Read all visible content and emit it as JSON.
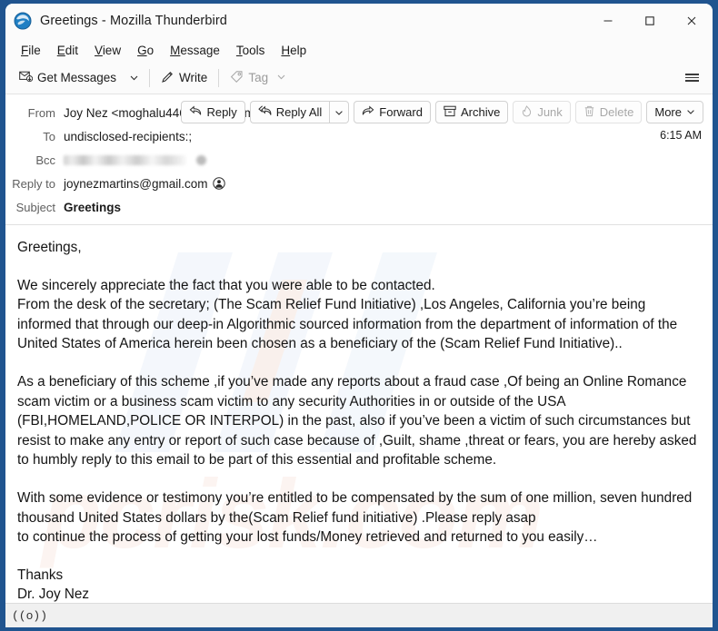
{
  "window": {
    "title": "Greetings - Mozilla Thunderbird",
    "logo_icon": "thunderbird-logo",
    "controls": {
      "minimize": "minimize-icon",
      "maximize": "maximize-icon",
      "close": "close-icon"
    }
  },
  "menubar": {
    "items": [
      {
        "label": "File",
        "accel": "F"
      },
      {
        "label": "Edit",
        "accel": "E"
      },
      {
        "label": "View",
        "accel": "V"
      },
      {
        "label": "Go",
        "accel": "G"
      },
      {
        "label": "Message",
        "accel": "M"
      },
      {
        "label": "Tools",
        "accel": "T"
      },
      {
        "label": "Help",
        "accel": "H"
      }
    ]
  },
  "toolbar": {
    "get_messages_label": "Get Messages",
    "get_messages_icon": "envelope-download-icon",
    "get_messages_caret": "chevron-down-icon",
    "write_label": "Write",
    "write_icon": "pencil-icon",
    "tag_label": "Tag",
    "tag_icon": "tag-icon",
    "tag_caret": "chevron-down-icon",
    "tag_disabled": true,
    "app_menu_icon": "hamburger-menu-icon"
  },
  "message_header": {
    "rows": [
      {
        "label": "From",
        "value": "Joy Nez <moghalu446@gmail.com>",
        "avatar": "contact-avatar-icon",
        "bold": false,
        "redacted": false
      },
      {
        "label": "To",
        "value": "undisclosed-recipients:;",
        "avatar": null,
        "bold": false,
        "redacted": false
      },
      {
        "label": "Bcc",
        "value": "",
        "avatar": null,
        "bold": false,
        "redacted": true
      },
      {
        "label": "Reply to",
        "value": "joynezmartins@gmail.com",
        "avatar": "contact-avatar-icon",
        "bold": false,
        "redacted": false
      },
      {
        "label": "Subject",
        "value": "Greetings",
        "avatar": null,
        "bold": true,
        "redacted": false
      }
    ],
    "timestamp": "6:15 AM",
    "actions": [
      {
        "name": "reply",
        "label": "Reply",
        "icon": "reply-arrow-icon",
        "disabled": false,
        "split": false
      },
      {
        "name": "reply-all",
        "label": "Reply All",
        "icon": "reply-all-arrow-icon",
        "disabled": false,
        "split": true,
        "split_icon": "chevron-down-icon"
      },
      {
        "name": "forward",
        "label": "Forward",
        "icon": "forward-arrow-icon",
        "disabled": false,
        "split": false
      },
      {
        "name": "archive",
        "label": "Archive",
        "icon": "archive-box-icon",
        "disabled": false,
        "split": false
      },
      {
        "name": "junk",
        "label": "Junk",
        "icon": "junk-flame-icon",
        "disabled": true,
        "split": false
      },
      {
        "name": "delete",
        "label": "Delete",
        "icon": "trash-icon",
        "disabled": true,
        "split": false
      },
      {
        "name": "more",
        "label": "More",
        "icon": "chevron-down-icon",
        "disabled": false,
        "split": false,
        "icon_after": true
      }
    ]
  },
  "message_body": {
    "watermark_text": "pcrisk.com",
    "paragraphs": [
      "Greetings,",
      "We sincerely appreciate the fact that you were able to be contacted.\nFrom the desk of the secretary; (The Scam Relief Fund Initiative) ,Los Angeles, California you’re being informed that through our deep-in Algorithmic sourced information from the department of information of the United States of America herein been chosen as a beneficiary of the (Scam Relief Fund Initiative)..",
      "As a beneficiary of this scheme ,if you’ve made any reports about a fraud case ,Of being an Online Romance scam victim or a business scam victim to any security Authorities in or outside of the USA (FBI,HOMELAND,POLICE OR INTERPOL) in the past, also if you’ve been a victim of such circumstances but resist to make any entry or report of such case because of ,Guilt, shame ,threat or fears, you are hereby asked to humbly reply to this email to be part of this essential and profitable scheme.",
      "With some evidence or testimony you’re entitled to be compensated by the sum of one million, seven hundred thousand United States dollars by the(Scam Relief fund initiative) .Please reply asap\nto continue the process of getting your lost funds/Money retrieved and returned to you easily…",
      "Thanks\nDr. Joy Nez\n(Ass. Secretary,TSRFIP ,LA)"
    ]
  },
  "statusbar": {
    "connection_icon": "((o))",
    "connection_icon_name": "online-status-icon"
  }
}
